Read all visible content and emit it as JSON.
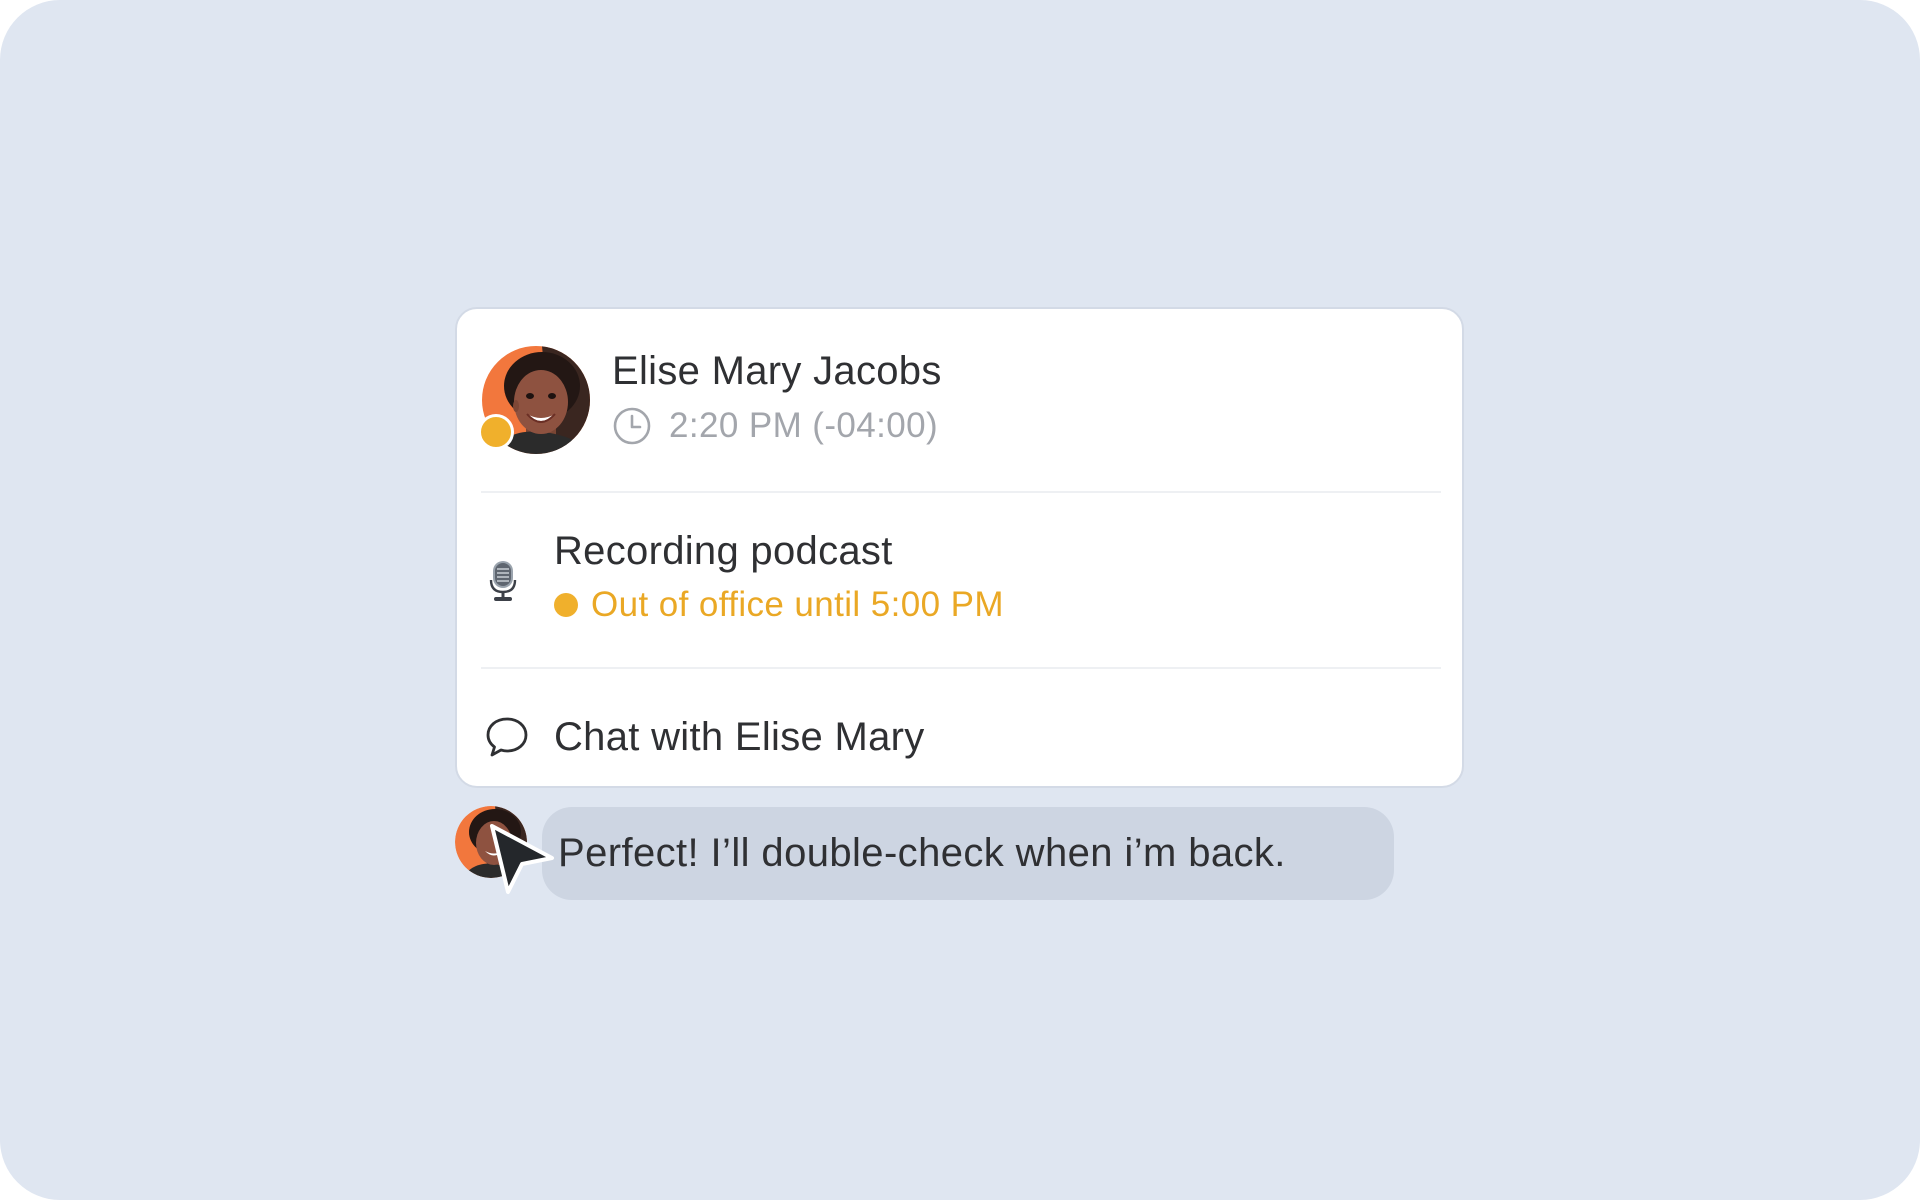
{
  "profile_card": {
    "name": "Elise Mary Jacobs",
    "local_time": "2:20 PM (-04:00)",
    "presence_color": "#f0b02c"
  },
  "status": {
    "title": "Recording podcast",
    "availability": "Out of office until 5:00 PM",
    "availability_color": "#eaa825",
    "icon": "microphone-icon"
  },
  "actions": {
    "chat_label": "Chat with Elise Mary",
    "chat_icon": "speech-bubble-icon"
  },
  "message": {
    "text": "Perfect! I’ll double-check when i’m back."
  },
  "colors": {
    "background": "#dfe6f1",
    "card": "#ffffff",
    "bubble": "#cdd5e2",
    "avatar_accent": "#f2773d"
  }
}
